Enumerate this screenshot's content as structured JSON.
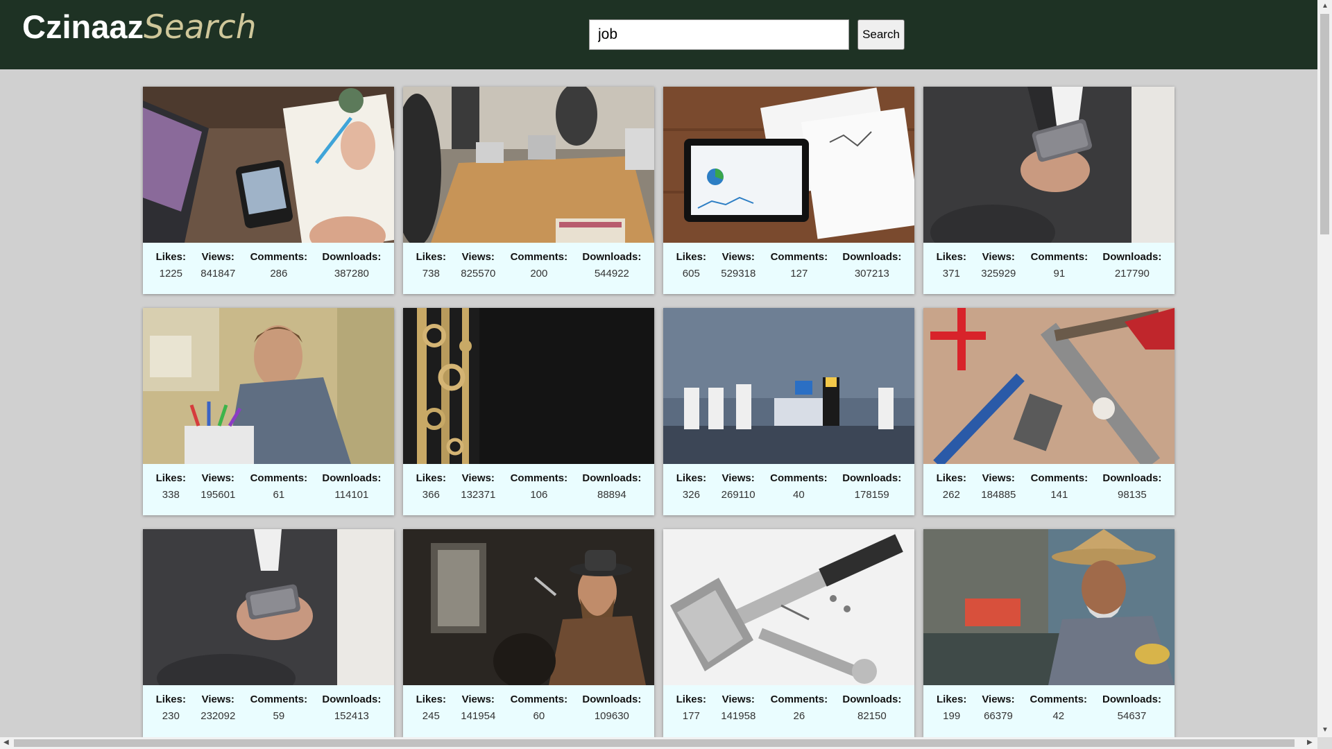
{
  "brand": {
    "part1": "Czinaaz",
    "part2": "Search"
  },
  "search": {
    "value": "job",
    "button_label": "Search"
  },
  "stat_labels": {
    "likes": "Likes:",
    "views": "Views:",
    "comments": "Comments:",
    "downloads": "Downloads:"
  },
  "cards": [
    {
      "likes": "1225",
      "views": "841847",
      "comments": "286",
      "downloads": "387280"
    },
    {
      "likes": "738",
      "views": "825570",
      "comments": "200",
      "downloads": "544922"
    },
    {
      "likes": "605",
      "views": "529318",
      "comments": "127",
      "downloads": "307213"
    },
    {
      "likes": "371",
      "views": "325929",
      "comments": "91",
      "downloads": "217790"
    },
    {
      "likes": "338",
      "views": "195601",
      "comments": "61",
      "downloads": "114101"
    },
    {
      "likes": "366",
      "views": "132371",
      "comments": "106",
      "downloads": "88894"
    },
    {
      "likes": "326",
      "views": "269110",
      "comments": "40",
      "downloads": "178159"
    },
    {
      "likes": "262",
      "views": "184885",
      "comments": "141",
      "downloads": "98135"
    },
    {
      "likes": "230",
      "views": "232092",
      "comments": "59",
      "downloads": "152413"
    },
    {
      "likes": "245",
      "views": "141954",
      "comments": "60",
      "downloads": "109630"
    },
    {
      "likes": "177",
      "views": "141958",
      "comments": "26",
      "downloads": "82150"
    },
    {
      "likes": "199",
      "views": "66379",
      "comments": "42",
      "downloads": "54637"
    }
  ]
}
